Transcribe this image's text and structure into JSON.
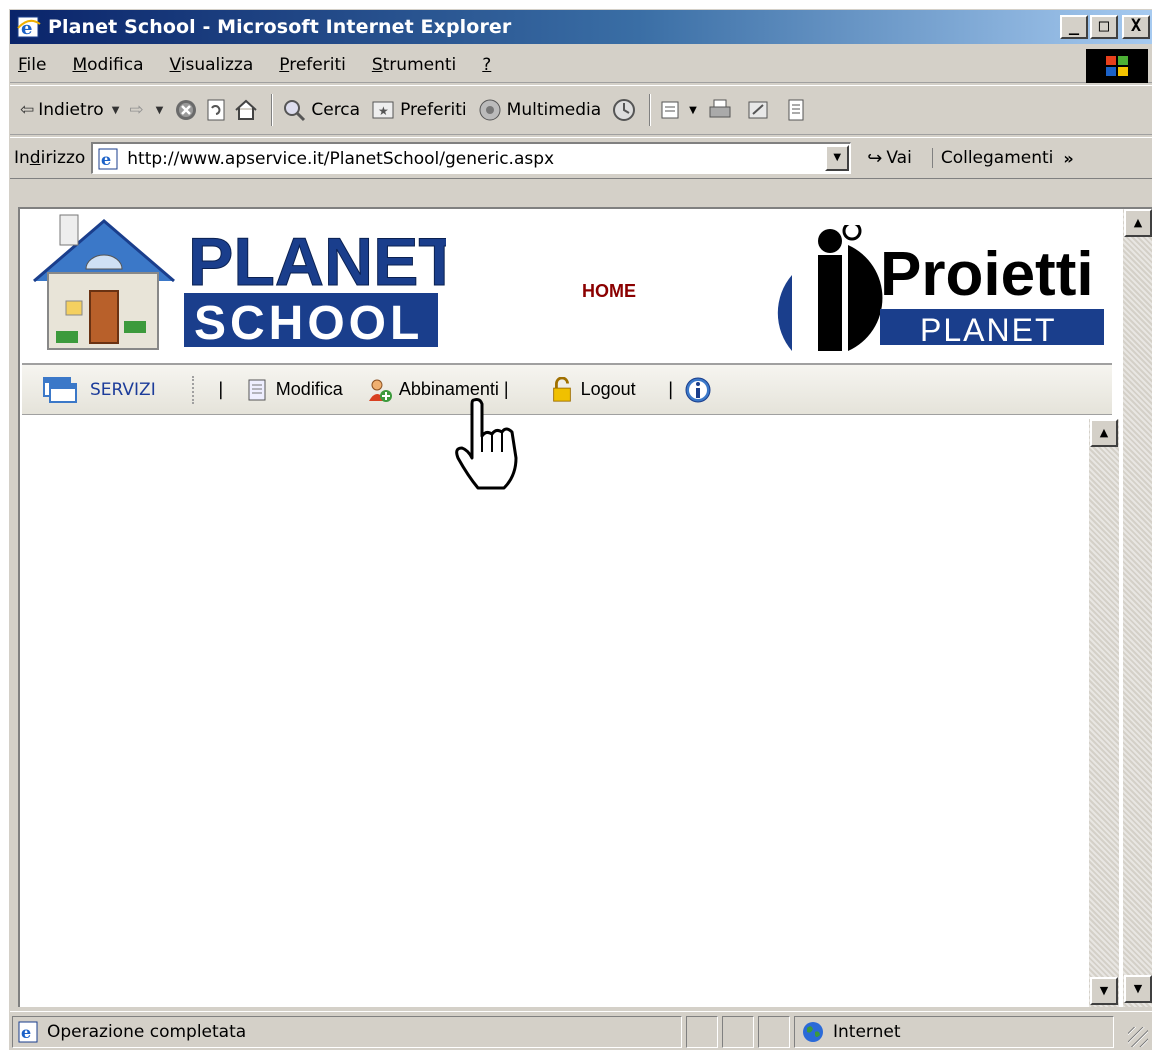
{
  "window": {
    "title": "Planet School - Microsoft Internet Explorer",
    "controls": [
      "_",
      "□",
      "X"
    ]
  },
  "menu": {
    "items": [
      {
        "key": "F",
        "rest": "ile"
      },
      {
        "key": "M",
        "rest": "odifica"
      },
      {
        "key": "V",
        "rest": "isualizza"
      },
      {
        "key": "P",
        "rest": "referiti"
      },
      {
        "key": "S",
        "rest": "trumenti"
      },
      {
        "key": "?",
        "rest": ""
      }
    ]
  },
  "toolbar": {
    "back": "Indietro",
    "search": "Cerca",
    "favorites": "Preferiti",
    "media": "Multimedia"
  },
  "address": {
    "label_pre": "In",
    "label_key": "d",
    "label_post": "irizzo",
    "url": "http://www.apservice.it/PlanetSchool/generic.aspx",
    "go": "Vai",
    "links": "Collegamenti",
    "chevron": "»"
  },
  "page": {
    "logo_left": {
      "line1": "PLANET",
      "line2": "SCHOOL"
    },
    "home_link": "HOME",
    "logo_right": {
      "line1": "Proietti",
      "line2": "PLANET"
    },
    "nav": {
      "servizi": "SERVIZI",
      "pipe": "|",
      "modifica": "Modifica",
      "abbinamenti": "Abbinamenti |",
      "logout": "Logout",
      "pipe2": "|"
    }
  },
  "status": {
    "text": "Operazione completata",
    "zone": "Internet"
  },
  "colors": {
    "titlebar_start": "#0a246a",
    "titlebar_end": "#a6caf0",
    "chrome": "#d4d0c8",
    "home_link": "#8b0000",
    "servizi_link": "#1c3c9a",
    "logo_blue": "#1a3e8c"
  },
  "icons": {
    "title": "ie-icon",
    "back": "back-arrow-icon",
    "forward": "forward-arrow-icon",
    "stop": "stop-icon",
    "refresh": "refresh-icon",
    "home": "home-icon",
    "search": "search-icon",
    "favorites": "favorites-icon",
    "media": "media-icon",
    "history": "history-icon",
    "mail": "mail-icon",
    "print": "print-icon",
    "edit": "edit-icon",
    "discuss": "discuss-icon",
    "status_page": "page-icon",
    "zone": "globe-icon",
    "cursor": "hand-cursor-icon"
  }
}
